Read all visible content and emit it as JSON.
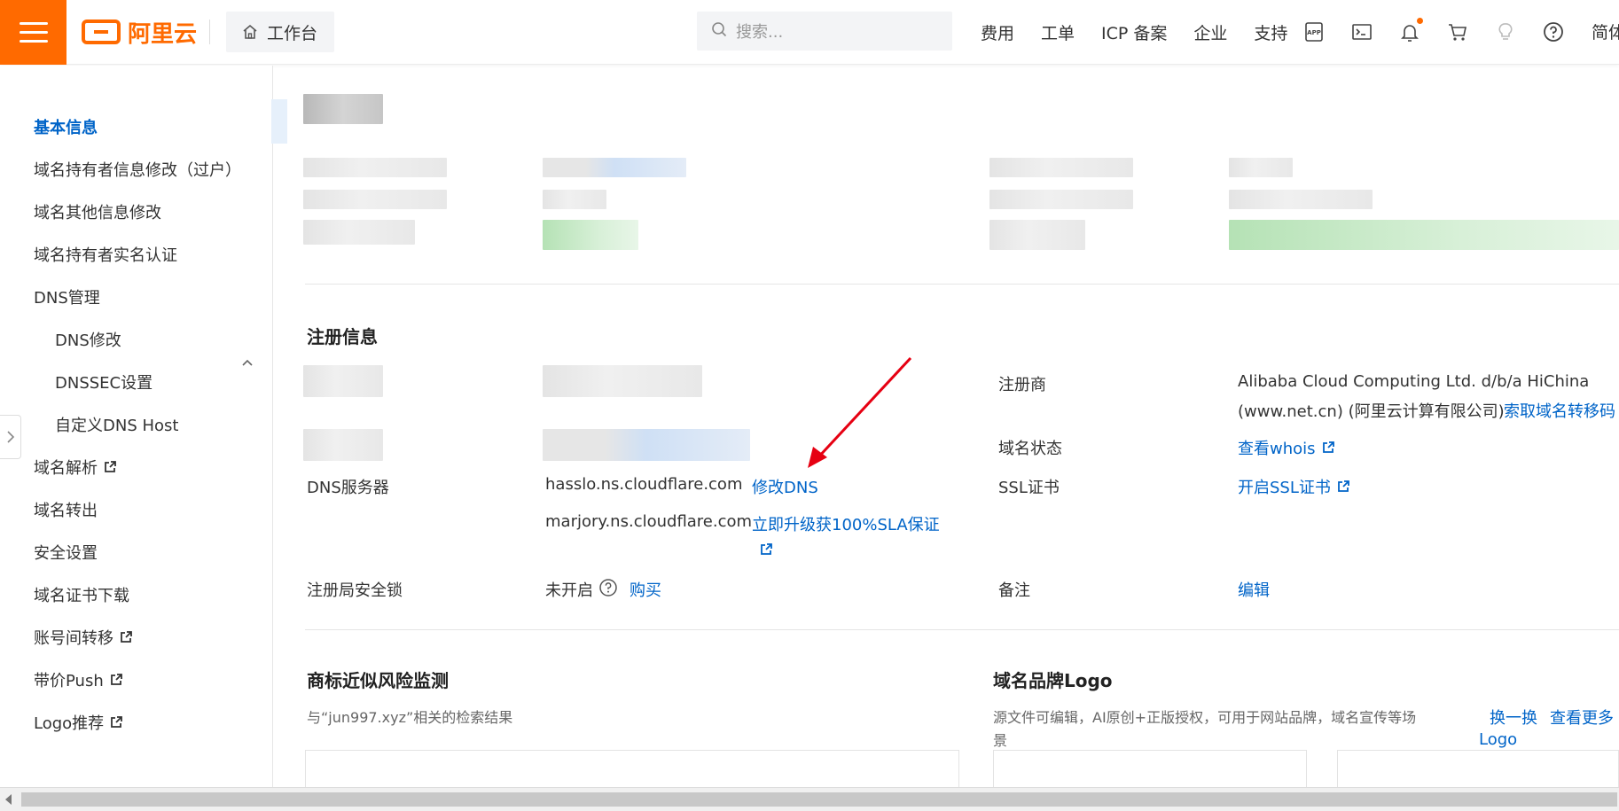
{
  "topbar": {
    "logo_text": "阿里云",
    "workbench_label": "工作台",
    "search_placeholder": "搜索...",
    "nav": [
      "费用",
      "工单",
      "ICP 备案",
      "企业",
      "支持"
    ],
    "lang_label": "简体",
    "icons": [
      "app-icon",
      "terminal-icon",
      "bell-icon",
      "cart-icon",
      "lightbulb-icon",
      "help-icon"
    ],
    "accent_color": "#ff6a00"
  },
  "sidebar": {
    "items": [
      {
        "label": "基本信息",
        "active": true
      },
      {
        "label": "域名持有者信息修改（过户）"
      },
      {
        "label": "域名其他信息修改"
      },
      {
        "label": "域名持有者实名认证"
      },
      {
        "label": "DNS管理",
        "expanded": true
      },
      {
        "label": "DNS修改",
        "sub": true
      },
      {
        "label": "DNSSEC设置",
        "sub": true
      },
      {
        "label": "自定义DNS Host",
        "sub": true
      },
      {
        "label": "域名解析",
        "external": true
      },
      {
        "label": "域名转出"
      },
      {
        "label": "安全设置"
      },
      {
        "label": "域名证书下载"
      },
      {
        "label": "账号间转移",
        "external": true
      },
      {
        "label": "带价Push",
        "external": true
      },
      {
        "label": "Logo推荐",
        "external": true
      }
    ]
  },
  "registration": {
    "title": "注册信息",
    "dns_label": "DNS服务器",
    "dns_servers": [
      "hasslo.ns.cloudflare.com",
      "marjory.ns.cloudflare.com"
    ],
    "modify_dns_link": "修改DNS",
    "upgrade_link": "立即升级获100%SLA保证",
    "lock_label": "注册局安全锁",
    "lock_status": "未开启",
    "buy_link": "购买",
    "registrar_label": "注册商",
    "registrar_value_line1": "Alibaba Cloud Computing Ltd. d/b/a HiChina",
    "registrar_value_line2": "(www.net.cn) (阿里云计算有限公司)",
    "transfer_code_link": "索取域名转移码",
    "status_label": "域名状态",
    "whois_link": "查看whois",
    "ssl_label": "SSL证书",
    "ssl_link": "开启SSL证书",
    "note_label": "备注",
    "edit_link": "编辑"
  },
  "trademark": {
    "title": "商标近似风险监测",
    "desc": "与“jun997.xyz”相关的检索结果"
  },
  "brand_logo": {
    "title": "域名品牌Logo",
    "desc_line1": "源文件可编辑，AI原创+正版授权，可用于网站品牌，域名宣传等场",
    "desc_line2": "景",
    "swap_link": "换一换",
    "more_link": "查看更多",
    "more_link_line2": "Logo"
  },
  "colors": {
    "link": "#0064c8",
    "arrow": "#e60012"
  }
}
